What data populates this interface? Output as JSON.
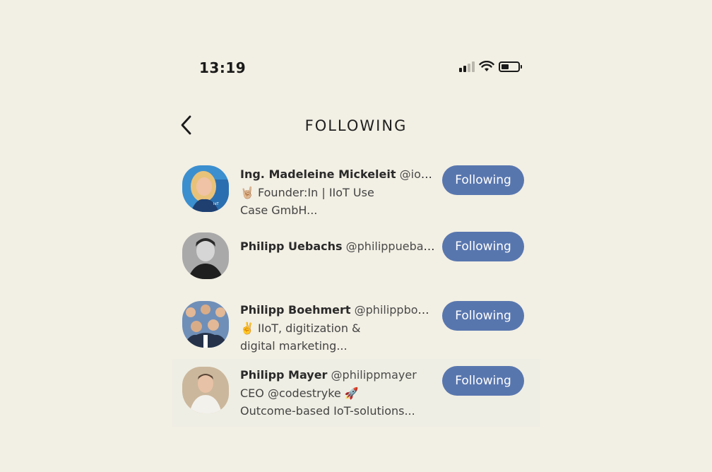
{
  "status_bar": {
    "time": "13:19"
  },
  "header": {
    "title": "FOLLOWING"
  },
  "users": [
    {
      "name": "Ing. Madeleine Mickeleit",
      "handle": "@iotus...",
      "bio_line1": "🤘🏼 Founder:In | IIoT Use",
      "bio_line2": "Case GmbH...",
      "button": "Following"
    },
    {
      "name": "Philipp Uebachs",
      "handle": "@philippuebac...",
      "bio_line1": "",
      "bio_line2": "",
      "button": "Following"
    },
    {
      "name": "Philipp Boehmert",
      "handle": "@philippboeh...",
      "bio_line1": "✌️ IIoT, digitization &",
      "bio_line2": "digital marketing...",
      "button": "Following"
    },
    {
      "name": "Philipp Mayer",
      "handle": "@philippmayer",
      "bio_line1": "CEO @codestryke 🚀",
      "bio_line2": "Outcome-based IoT-solutions...",
      "button": "Following"
    }
  ],
  "colors": {
    "background": "#f2efe4",
    "button": "#5876ae",
    "button_text": "#ffffff"
  }
}
